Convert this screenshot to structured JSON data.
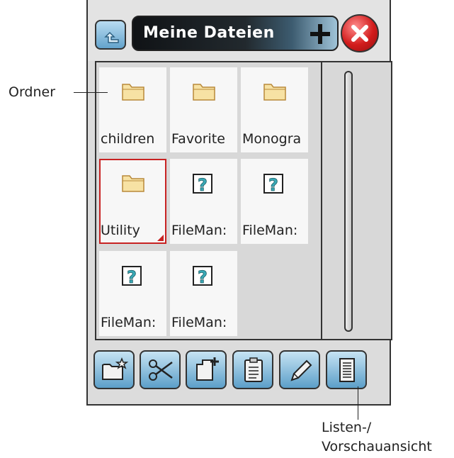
{
  "header": {
    "title": "Meine Dateien",
    "up_icon": "folder-up-icon",
    "add_icon": "plus-icon",
    "close_icon": "close-x-icon"
  },
  "files": [
    {
      "label": "children",
      "icon": "folder-icon",
      "selected": false
    },
    {
      "label": "Favorite",
      "icon": "folder-icon",
      "selected": false
    },
    {
      "label": "Monogra",
      "icon": "folder-icon",
      "selected": false
    },
    {
      "label": "Utility",
      "icon": "folder-icon",
      "selected": true
    },
    {
      "label": "FileMan:",
      "icon": "unknown-file-icon",
      "selected": false
    },
    {
      "label": "FileMan:",
      "icon": "unknown-file-icon",
      "selected": false
    },
    {
      "label": "FileMan:",
      "icon": "unknown-file-icon",
      "selected": false
    },
    {
      "label": "FileMan:",
      "icon": "unknown-file-icon",
      "selected": false
    }
  ],
  "toolbar": [
    {
      "icon": "new-folder-icon"
    },
    {
      "icon": "scissors-icon"
    },
    {
      "icon": "new-file-icon"
    },
    {
      "icon": "clipboard-icon"
    },
    {
      "icon": "pencil-icon"
    },
    {
      "icon": "list-view-icon"
    }
  ],
  "callouts": {
    "folder": "Ordner",
    "view_line1": "Listen-/",
    "view_line2": "Vorschauansicht"
  },
  "colors": {
    "accent_blue": "#63a3cc",
    "folder_fill": "#f7e2a4",
    "folder_stroke": "#b8893a",
    "selection_red": "#c82222",
    "close_red": "#d21c1c",
    "help_teal": "#3aa9b6"
  }
}
